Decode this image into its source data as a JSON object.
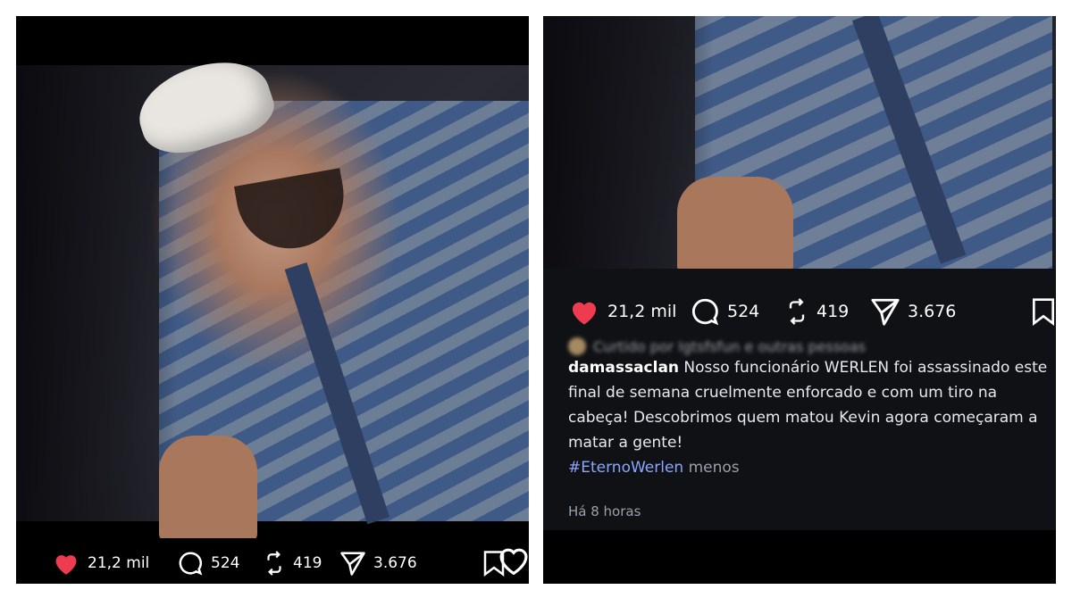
{
  "left_post": {
    "likes": "21,2 mil",
    "comments": "524",
    "reposts": "419",
    "shares": "3.676"
  },
  "right_post": {
    "likes": "21,2 mil",
    "comments": "524",
    "reposts": "419",
    "shares": "3.676",
    "liked_by": "Curtido por lgtsfsfun e outras pessoas",
    "username": "damassaclan",
    "caption": "Nosso funcionário WERLEN foi assassinado este final de semana cruelmente enforcado e com um tiro na cabeça! Descobrimos quem matou Kevin agora começaram a matar a gente!",
    "hashtag": "#EternoWerlen",
    "less_label": "menos",
    "time": "Há 8 horas"
  },
  "colors": {
    "heart": "#ef3b4f",
    "background": "#000000",
    "hashtag": "#8aa6ff",
    "caption_panel": "#0f1115"
  },
  "icons": [
    "heart-icon",
    "comment-icon",
    "repost-icon",
    "share-icon",
    "bookmark-icon",
    "heart-outline-icon"
  ]
}
